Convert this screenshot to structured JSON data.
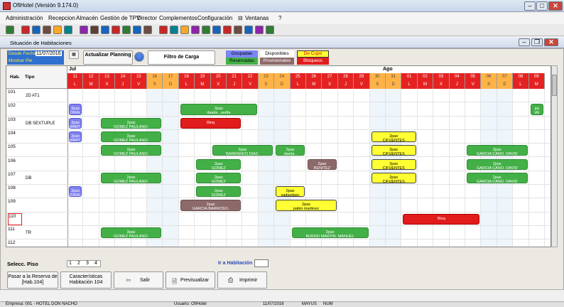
{
  "window": {
    "title": "OfiHotel (Versión 9.174.0)"
  },
  "menu": [
    "Administración",
    "Recepcion",
    "Almacén",
    "Gestión de TPV",
    "Director",
    "Complementos",
    "Configuración",
    "Ventanas",
    "?"
  ],
  "subwindow_title": "Situación de Habitaciones",
  "controls": {
    "desde_fecha_label": "Desde Fecha",
    "desde_fecha_value": "11/07/2016",
    "mostrar_pie": "Mostrar Pie",
    "actualizar": "Actualizar Planning",
    "filtro": "Filtro de Carga"
  },
  "legend": {
    "ocupadas": "Ocupadas",
    "disponibles": "Disponibles",
    "de_cupo": "De Cupo",
    "reservadas": "Reservadas",
    "provisionales": "Provisionales",
    "bloqueos": "Bloqueos",
    "colors": {
      "ocupadas": "#7b86f5",
      "disponibles": "#ffffff",
      "de_cupo": "#ffff33",
      "reservadas": "#43b047",
      "provisionales": "#8d6a6a",
      "bloqueos": "#e11c1c"
    }
  },
  "grid": {
    "hab_header": "Hab.",
    "tipo_header": "Tipo",
    "months": [
      "Jul",
      "Ago"
    ],
    "days": [
      "11",
      "12",
      "13",
      "14",
      "15",
      "16",
      "17",
      "18",
      "19",
      "20",
      "21",
      "22",
      "23",
      "24",
      "25",
      "26",
      "27",
      "28",
      "29",
      "30",
      "31",
      "01",
      "02",
      "03",
      "04",
      "05",
      "06",
      "07",
      "08",
      "09"
    ],
    "dow": [
      "L",
      "M",
      "X",
      "J",
      "V",
      "S",
      "D",
      "L",
      "M",
      "X",
      "J",
      "V",
      "S",
      "D",
      "L",
      "M",
      "X",
      "J",
      "V",
      "S",
      "D",
      "L",
      "M",
      "X",
      "J",
      "V",
      "S",
      "D",
      "L",
      "M"
    ],
    "rooms": [
      {
        "num": "101",
        "tipo": "2D AT1"
      },
      {
        "num": "102",
        "tipo": ""
      },
      {
        "num": "103",
        "tipo": "DB SEXTUPLE"
      },
      {
        "num": "104",
        "tipo": ""
      },
      {
        "num": "105",
        "tipo": ""
      },
      {
        "num": "106",
        "tipo": ""
      },
      {
        "num": "107",
        "tipo": "DB"
      },
      {
        "num": "108",
        "tipo": ""
      },
      {
        "num": "109",
        "tipo": ""
      },
      {
        "num": "110",
        "tipo": ""
      },
      {
        "num": "111",
        "tipo": "TR"
      },
      {
        "num": "112",
        "tipo": ""
      }
    ],
    "reservations": [
      {
        "row": 1,
        "start": 0,
        "len": 1,
        "cls": "p",
        "l1": "2pax",
        "l2": "ORAL"
      },
      {
        "row": 2,
        "start": 0,
        "len": 1,
        "cls": "p",
        "l1": "2pax",
        "l2": "MARTI"
      },
      {
        "row": 3,
        "start": 0,
        "len": 1,
        "cls": "p",
        "l1": "2pax",
        "l2": "MARTI"
      },
      {
        "row": 7,
        "start": 0,
        "len": 1,
        "cls": "p",
        "l1": "2pax",
        "l2": "IORAL"
      },
      {
        "row": 2,
        "start": 2,
        "len": 4,
        "cls": "g",
        "l1": "2pax",
        "l2": "GOMEZ PAULANO,"
      },
      {
        "row": 3,
        "start": 2,
        "len": 4,
        "cls": "g",
        "l1": "2pax",
        "l2": "GOMEZ PAULANO,"
      },
      {
        "row": 4,
        "start": 2,
        "len": 4,
        "cls": "g",
        "l1": "2pax",
        "l2": "GOMEZ PAULANO,"
      },
      {
        "row": 6,
        "start": 2,
        "len": 4,
        "cls": "g",
        "l1": "2pax",
        "l2": "GOMEZ PAULANO,"
      },
      {
        "row": 10,
        "start": 2,
        "len": 4,
        "cls": "g",
        "l1": "3pax",
        "l2": "GOMEZ PAULANO,"
      },
      {
        "row": 1,
        "start": 7,
        "len": 5,
        "cls": "g",
        "l1": "2pax",
        "l2": "dasda , asdfa"
      },
      {
        "row": 2,
        "start": 7,
        "len": 4,
        "cls": "r",
        "l1": "Bloq",
        "l2": ""
      },
      {
        "row": 4,
        "start": 9,
        "len": 4,
        "cls": "g",
        "l1": "2pax",
        "l2": "BARRANCO DIAZ,"
      },
      {
        "row": 4,
        "start": 13,
        "len": 2,
        "cls": "g",
        "l1": "2pax",
        "l2": "dasda ,"
      },
      {
        "row": 5,
        "start": 8,
        "len": 3,
        "cls": "g",
        "l1": "2pax",
        "l2": "GOMEZ"
      },
      {
        "row": 6,
        "start": 8,
        "len": 3,
        "cls": "g",
        "l1": "2pax",
        "l2": "GOMEZ"
      },
      {
        "row": 7,
        "start": 8,
        "len": 3,
        "cls": "g",
        "l1": "2pax",
        "l2": "GOMEZ"
      },
      {
        "row": 8,
        "start": 7,
        "len": 4,
        "cls": "b",
        "l1": "2pax",
        "l2": "GARCIA BARROSO,"
      },
      {
        "row": 5,
        "start": 15,
        "len": 2,
        "cls": "b",
        "l1": "2pax",
        "l2": "BENITEZ"
      },
      {
        "row": 7,
        "start": 13,
        "len": 2,
        "cls": "y",
        "l1": "2pax",
        "l2": "vadasdasc"
      },
      {
        "row": 8,
        "start": 13,
        "len": 4,
        "cls": "y",
        "l1": "2pax",
        "l2": "pablo martinez"
      },
      {
        "row": 10,
        "start": 14,
        "len": 5,
        "cls": "g",
        "l1": "3pax",
        "l2": "BUENO MARTIN, MANUEL"
      },
      {
        "row": 3,
        "start": 19,
        "len": 3,
        "cls": "y",
        "l1": "2pax",
        "l2": "CIFUENTES"
      },
      {
        "row": 4,
        "start": 19,
        "len": 3,
        "cls": "y",
        "l1": "2pax",
        "l2": "CIFUENTES"
      },
      {
        "row": 5,
        "start": 19,
        "len": 3,
        "cls": "y",
        "l1": "2pax",
        "l2": "CIFUENTES"
      },
      {
        "row": 6,
        "start": 19,
        "len": 3,
        "cls": "y",
        "l1": "2pax",
        "l2": "CIFUENTES"
      },
      {
        "row": 9,
        "start": 21,
        "len": 5,
        "cls": "r",
        "l1": "Bloq",
        "l2": ""
      },
      {
        "row": 4,
        "start": 25,
        "len": 4,
        "cls": "g",
        "l1": "2pax",
        "l2": "GARCIA CANO, DAVID"
      },
      {
        "row": 5,
        "start": 25,
        "len": 4,
        "cls": "g",
        "l1": "2pax",
        "l2": "GARCIA CANO, DAVID"
      },
      {
        "row": 6,
        "start": 25,
        "len": 4,
        "cls": "g",
        "l1": "2pax",
        "l2": "GARCIA CANO, DAVID"
      },
      {
        "row": 1,
        "start": 29,
        "len": 1,
        "cls": "g",
        "l1": "pa",
        "l2": "IAI"
      }
    ]
  },
  "bottom": {
    "selecc_piso": "Selecc. Piso",
    "pisos": [
      "1",
      "2",
      "3",
      "4"
    ],
    "ir_habitacion": "Ir a Habitación",
    "btn_pasar": "Pasar a la Reserva de [Hab.104]",
    "btn_caract": "Características Habitación 104",
    "btn_salir": "Salir",
    "btn_previsualizar": "Previsualizar",
    "btn_imprimir": "Imprimir"
  },
  "status": {
    "empresa": "Empresa: 001 - HOTEL DON NACHO",
    "usuario": "Usuario: OfiHotel",
    "fecha": "11/07/2016",
    "mayus": "MAYUS",
    "num": "NUM"
  }
}
